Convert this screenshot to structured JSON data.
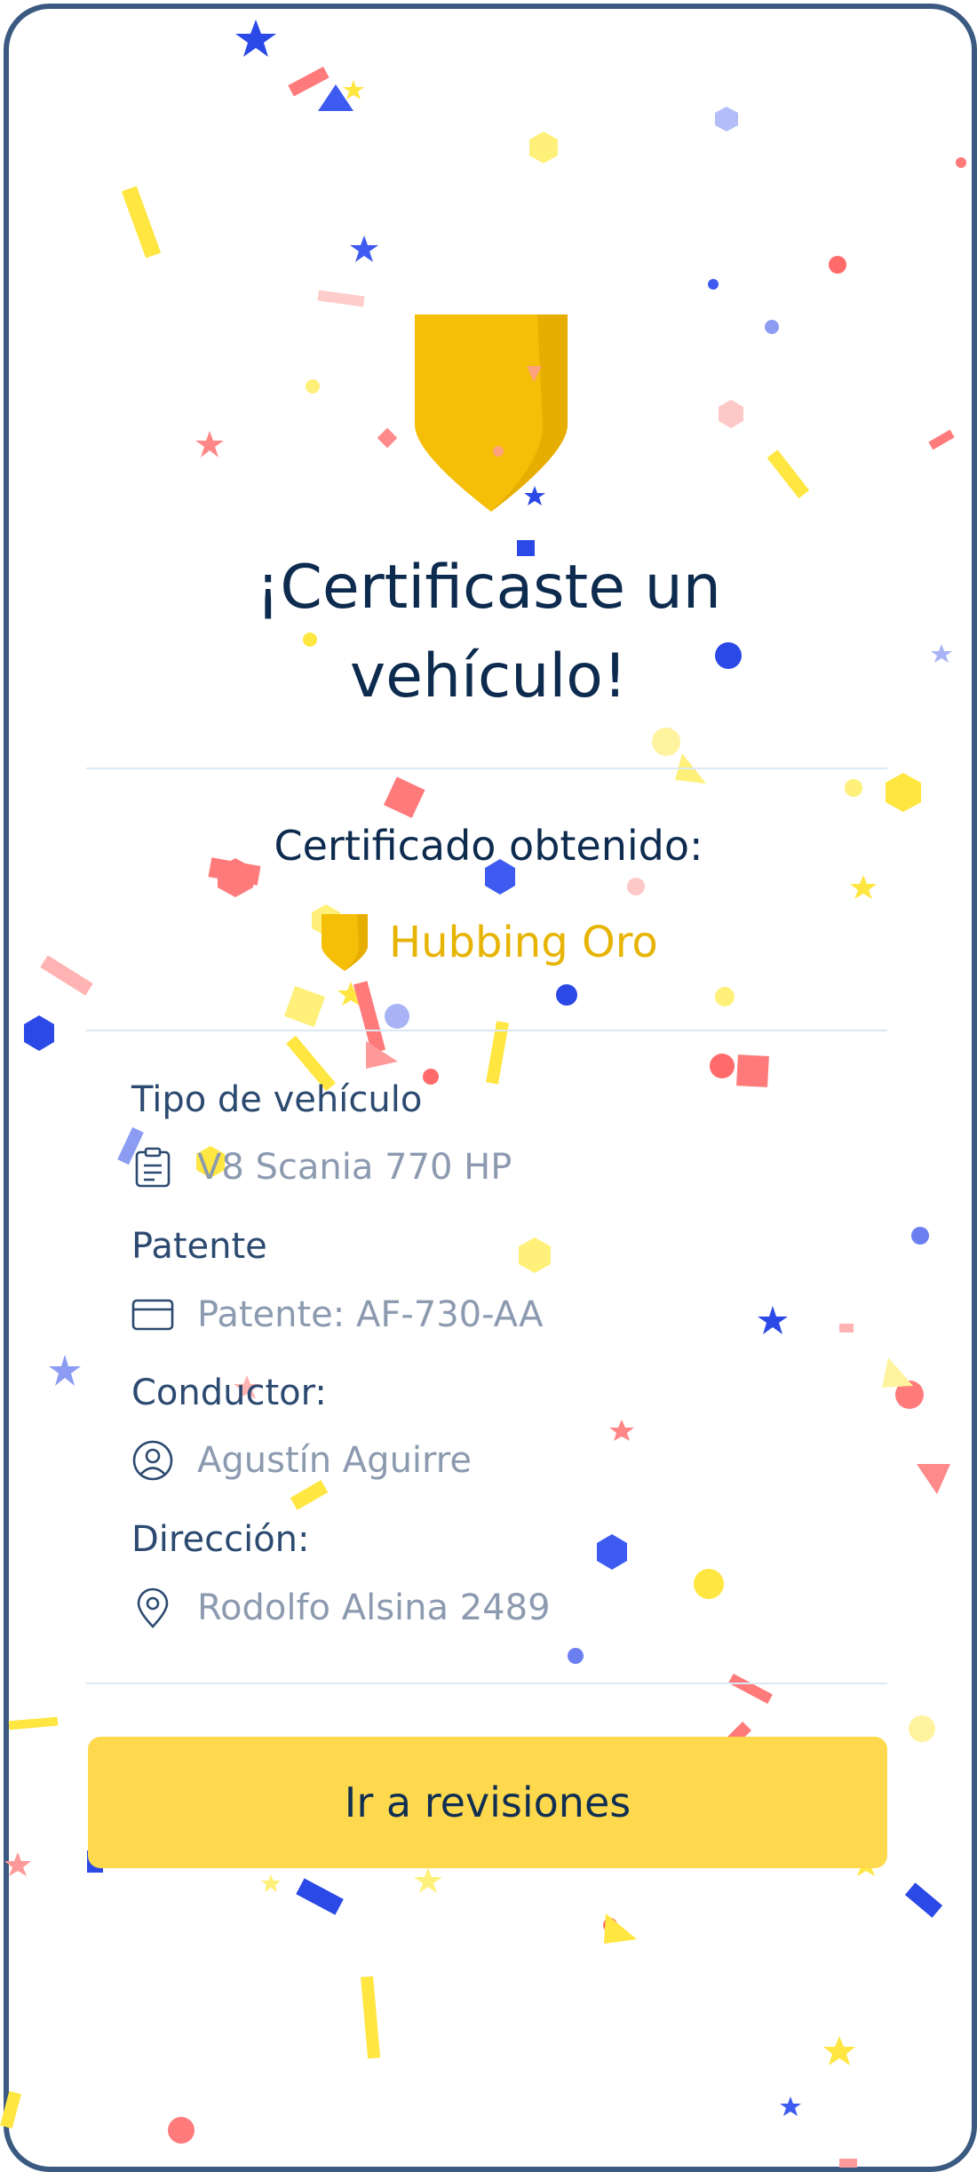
{
  "title": "¡Certificaste un vehículo!",
  "certificate": {
    "label": "Certificado obtenido:",
    "name": "Hubbing Oro",
    "badge_icon": "gold-shield-icon"
  },
  "details": [
    {
      "label": "Tipo de vehículo",
      "value": "V8 Scania 770 HP",
      "icon": "clipboard-icon"
    },
    {
      "label": "Patente",
      "value": "Patente: AF-730-AA",
      "icon": "credit-card-icon"
    },
    {
      "label": "Conductor:",
      "value": "Agustín Aguirre",
      "icon": "user-circle-icon"
    },
    {
      "label": "Dirección:",
      "value": "Rodolfo Alsina 2489",
      "icon": "map-pin-icon"
    }
  ],
  "cta": {
    "label": "Ir a revisiones"
  },
  "colors": {
    "frame": "#3b5a82",
    "title": "#0d2b4e",
    "gold": "#f5bf08",
    "gold_text": "#e7b404",
    "cta_bg": "#ffd94d",
    "muted_text": "#8c9ab0"
  }
}
